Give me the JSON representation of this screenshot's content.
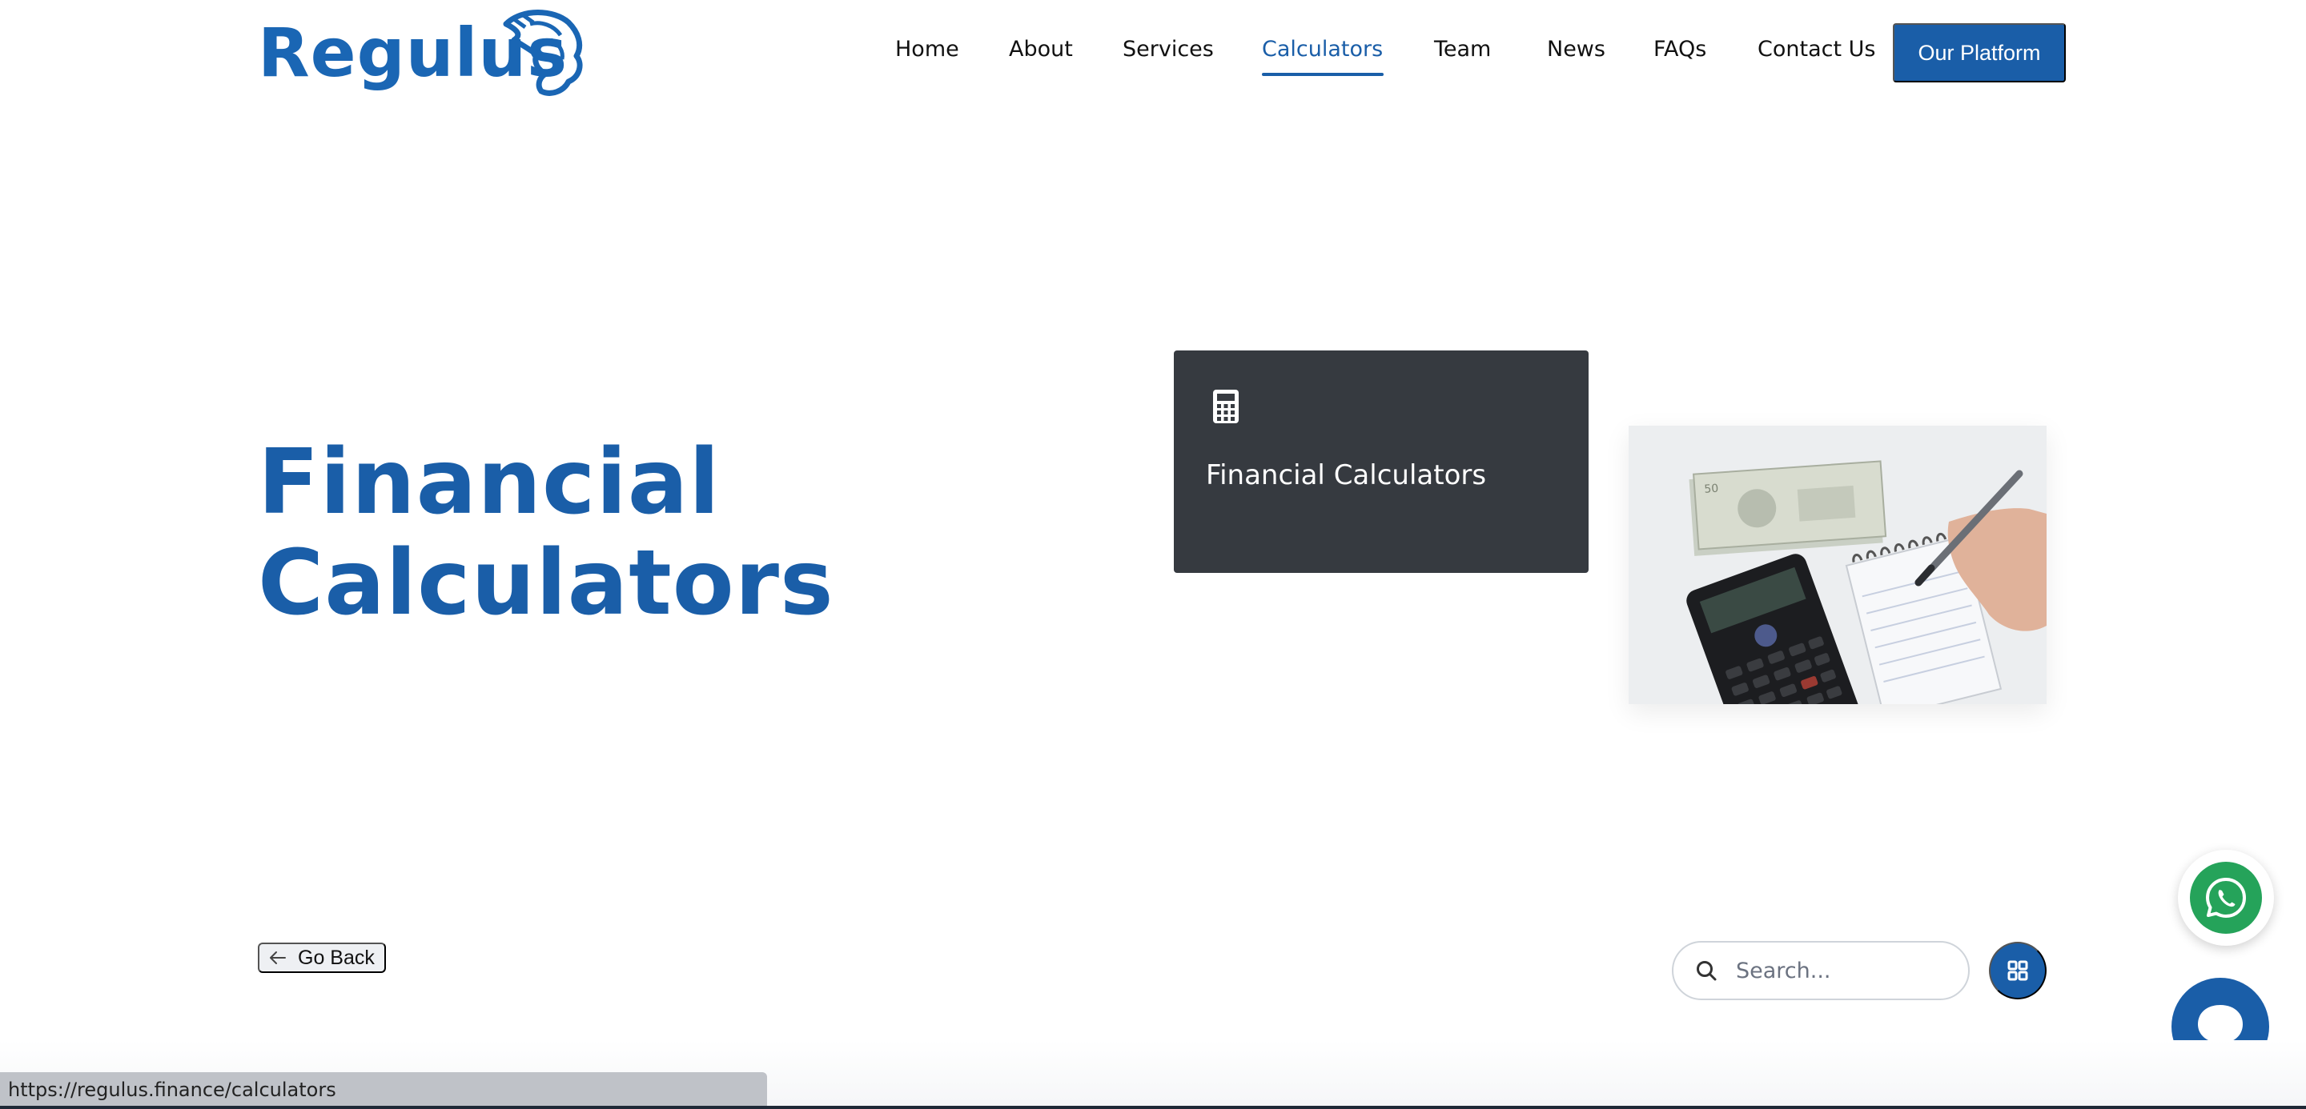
{
  "brand": {
    "name": "Regulus",
    "color": "#1a66b4"
  },
  "nav": {
    "items": [
      {
        "label": "Home"
      },
      {
        "label": "About"
      },
      {
        "label": "Services"
      },
      {
        "label": "Calculators"
      },
      {
        "label": "Team"
      },
      {
        "label": "News"
      },
      {
        "label": "FAQs"
      },
      {
        "label": "Contact Us"
      }
    ],
    "active": "Calculators",
    "platform_button": "Our Platform"
  },
  "hero": {
    "title_line1": "Financial",
    "title_line2": "Calculators",
    "card_title": "Financial Calculators",
    "card_icon": "calculator-icon"
  },
  "controls": {
    "go_back": "Go Back",
    "search_placeholder": "Search..."
  },
  "status_bar": {
    "url": "https://regulus.finance/calculators"
  },
  "colors": {
    "accent": "#1a5ea8",
    "card_bg": "#363a40",
    "whatsapp": "#25a35a"
  }
}
